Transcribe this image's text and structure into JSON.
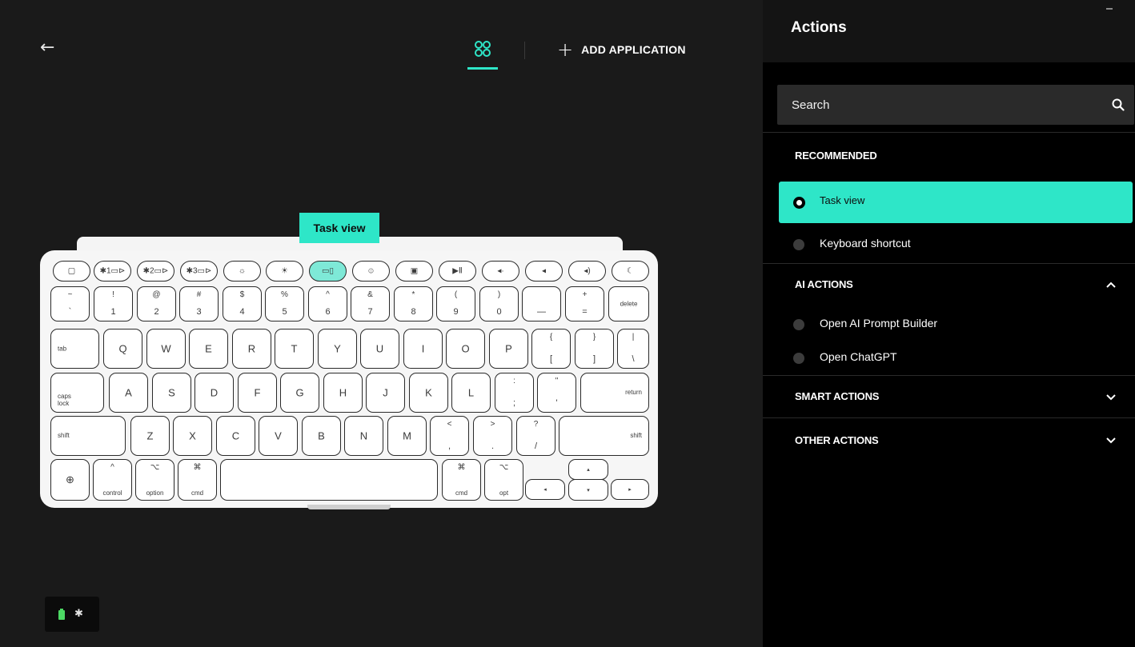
{
  "header": {
    "back_icon": "arrow-left-icon",
    "apps_icon": "apps-grid-icon",
    "add_application_label": "ADD APPLICATION"
  },
  "keyboard": {
    "tooltip": "Task view",
    "fn_row": [
      {
        "label": "▢"
      },
      {
        "label": "✱1▭⊳"
      },
      {
        "label": "✱2▭⊳"
      },
      {
        "label": "✱3▭⊳"
      },
      {
        "label": "☼"
      },
      {
        "label": "☀"
      },
      {
        "label": "▭▯"
      },
      {
        "label": "☺"
      },
      {
        "label": "▣"
      },
      {
        "label": "▶Ⅱ"
      },
      {
        "label": "◂·"
      },
      {
        "label": "◂"
      },
      {
        "label": "◂)"
      },
      {
        "label": "☾"
      }
    ],
    "number_row": [
      {
        "top": "~",
        "bottom": "`"
      },
      {
        "top": "!",
        "bottom": "1"
      },
      {
        "top": "@",
        "bottom": "2"
      },
      {
        "top": "#",
        "bottom": "3"
      },
      {
        "top": "$",
        "bottom": "4"
      },
      {
        "top": "%",
        "bottom": "5"
      },
      {
        "top": "^",
        "bottom": "6"
      },
      {
        "top": "&",
        "bottom": "7"
      },
      {
        "top": "*",
        "bottom": "8"
      },
      {
        "top": "(",
        "bottom": "9"
      },
      {
        "top": ")",
        "bottom": "0"
      },
      {
        "top": "",
        "bottom": "—"
      },
      {
        "top": "+",
        "bottom": "="
      },
      {
        "top": "",
        "bottom": "delete"
      }
    ],
    "qwerty_row": [
      "tab",
      "Q",
      "W",
      "E",
      "R",
      "T",
      "Y",
      "U",
      "I",
      "O",
      "P"
    ],
    "bracket_keys": [
      {
        "top": "{",
        "bottom": "["
      },
      {
        "top": "}",
        "bottom": "]"
      },
      {
        "top": "|",
        "bottom": "\\"
      }
    ],
    "home_row": [
      "A",
      "S",
      "D",
      "F",
      "G",
      "H",
      "J",
      "K",
      "L"
    ],
    "caps_label": "caps\nlock",
    "home_punct": [
      {
        "top": ":",
        "bottom": ";"
      },
      {
        "top": "\"",
        "bottom": "'"
      }
    ],
    "return_label": "return",
    "shift_label": "shift",
    "bottom_letters": [
      "Z",
      "X",
      "C",
      "V",
      "B",
      "N",
      "M"
    ],
    "bottom_punct": [
      {
        "top": "<",
        "bottom": ","
      },
      {
        "top": ">",
        "bottom": "."
      },
      {
        "top": "?",
        "bottom": "/"
      }
    ],
    "shift_right_label": "shift",
    "modifiers": {
      "globe": "⊕",
      "control": {
        "sym": "^",
        "label": "control"
      },
      "option": {
        "sym": "⌥",
        "label": "option"
      },
      "cmd": {
        "sym": "⌘",
        "label": "cmd"
      },
      "cmd_right": {
        "sym": "⌘",
        "label": "cmd"
      },
      "opt_right": {
        "sym": "⌥",
        "label": "opt"
      }
    },
    "arrows": {
      "left": "◂",
      "up": "▴",
      "down": "▾",
      "right": "▸"
    }
  },
  "status_bar": {
    "battery_icon": "battery-icon",
    "bluetooth_icon": "bluetooth-icon",
    "bluetooth_glyph": "✱"
  },
  "panel": {
    "title": "Actions",
    "search_placeholder": "Search",
    "search_icon": "search-icon",
    "sections": {
      "recommended": {
        "title": "RECOMMENDED",
        "items": [
          {
            "label": "Task view",
            "selected": true
          },
          {
            "label": "Keyboard shortcut",
            "selected": false
          }
        ]
      },
      "ai_actions": {
        "title": "AI ACTIONS",
        "expanded": true,
        "items": [
          {
            "label": "Open AI Prompt Builder"
          },
          {
            "label": "Open ChatGPT"
          }
        ]
      },
      "smart_actions": {
        "title": "SMART ACTIONS",
        "expanded": false
      },
      "other_actions": {
        "title": "OTHER ACTIONS",
        "expanded": false
      }
    }
  },
  "colors": {
    "accent": "#2ee6c8",
    "panel_bg": "#000000",
    "main_bg": "#1a1a1a",
    "key_selected": "#7ee9d7"
  }
}
